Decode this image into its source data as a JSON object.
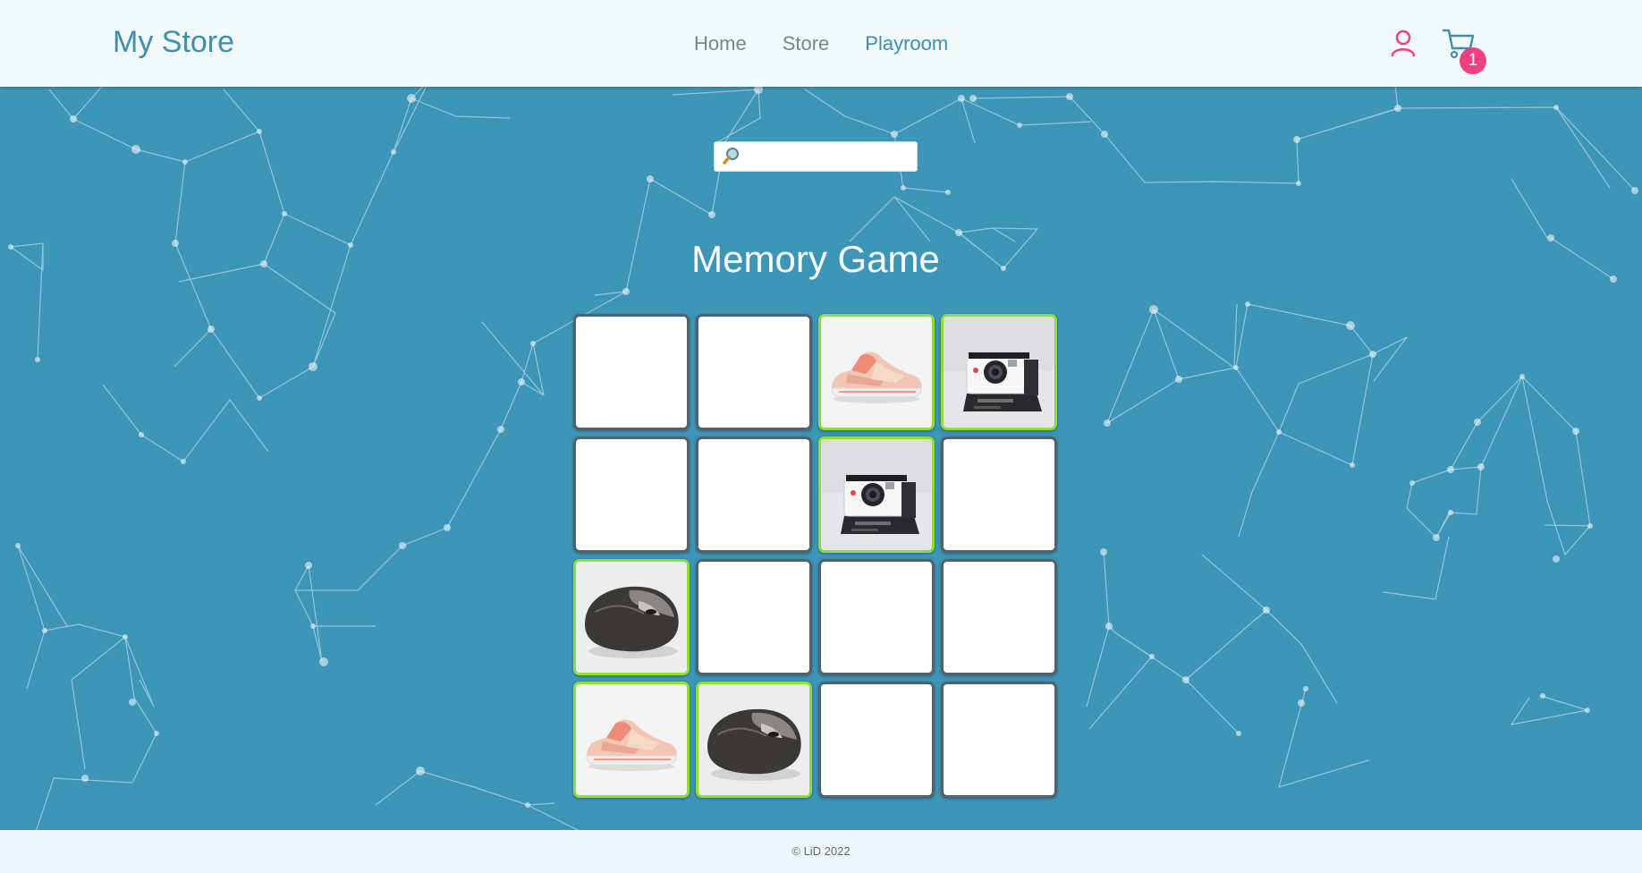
{
  "header": {
    "brand": "My Store",
    "nav": [
      {
        "label": "Home",
        "active": false
      },
      {
        "label": "Store",
        "active": false
      },
      {
        "label": "Playroom",
        "active": true
      }
    ],
    "cart_count": "1",
    "user_icon": "user-icon",
    "cart_icon": "cart-icon"
  },
  "search": {
    "value": "",
    "placeholder": "",
    "icon": "search-icon"
  },
  "game": {
    "title": "Memory Game",
    "cards": [
      {
        "state": "hidden",
        "item": ""
      },
      {
        "state": "hidden",
        "item": ""
      },
      {
        "state": "matched",
        "item": "sneaker"
      },
      {
        "state": "matched",
        "item": "camera"
      },
      {
        "state": "hidden",
        "item": ""
      },
      {
        "state": "hidden",
        "item": ""
      },
      {
        "state": "matched",
        "item": "camera"
      },
      {
        "state": "hidden",
        "item": ""
      },
      {
        "state": "matched",
        "item": "mouse"
      },
      {
        "state": "hidden",
        "item": ""
      },
      {
        "state": "hidden",
        "item": ""
      },
      {
        "state": "hidden",
        "item": ""
      },
      {
        "state": "matched",
        "item": "sneaker"
      },
      {
        "state": "matched",
        "item": "mouse"
      },
      {
        "state": "hidden",
        "item": ""
      },
      {
        "state": "hidden",
        "item": ""
      }
    ]
  },
  "footer": {
    "text": "© LiD 2022"
  },
  "colors": {
    "background": "#3d96b8",
    "brand": "#3d8fb0",
    "accent_pink": "#ef3f7e",
    "match_border": "#8ee02e"
  }
}
